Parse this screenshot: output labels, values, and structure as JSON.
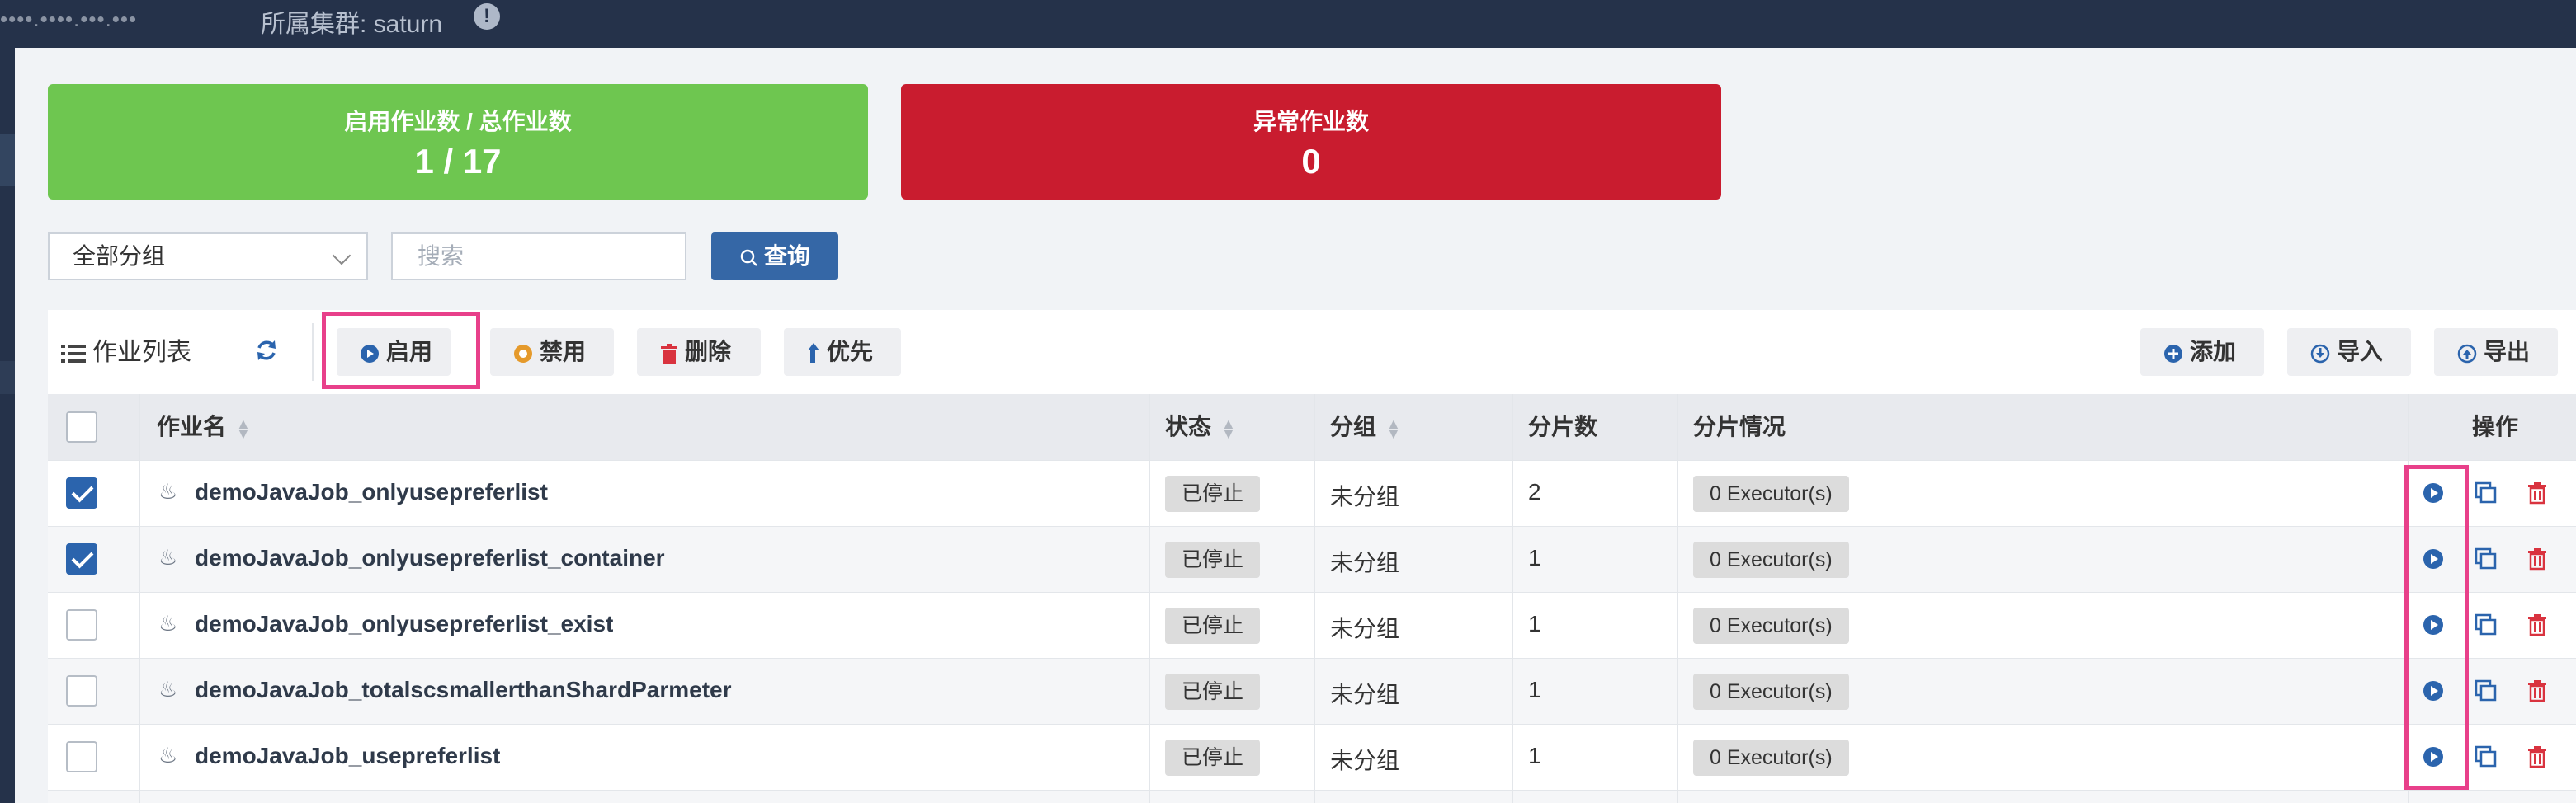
{
  "topbar": {
    "host": "••••.••••.•••.•••",
    "cluster_label": "所属集群: saturn"
  },
  "stats": {
    "enabled_label": "启用作业数 / 总作业数",
    "enabled_value": "1 / 17",
    "abnormal_label": "异常作业数",
    "abnormal_value": "0"
  },
  "filter": {
    "group_selected": "全部分组",
    "search_placeholder": "搜索",
    "query_label": "查询"
  },
  "toolbar": {
    "title": "作业列表",
    "enable_label": "启用",
    "disable_label": "禁用",
    "delete_label": "删除",
    "priority_label": "优先",
    "add_label": "添加",
    "import_label": "导入",
    "export_label": "导出"
  },
  "table": {
    "headers": {
      "name": "作业名",
      "status": "状态",
      "group": "分组",
      "shards": "分片数",
      "shard_status": "分片情况",
      "actions": "操作"
    },
    "rows": [
      {
        "checked": true,
        "name": "demoJavaJob_onlyusepreferlist",
        "status": "已停止",
        "group": "未分组",
        "shards": "2",
        "shard_status": "0 Executor(s)"
      },
      {
        "checked": true,
        "name": "demoJavaJob_onlyusepreferlist_container",
        "status": "已停止",
        "group": "未分组",
        "shards": "1",
        "shard_status": "0 Executor(s)"
      },
      {
        "checked": false,
        "name": "demoJavaJob_onlyusepreferlist_exist",
        "status": "已停止",
        "group": "未分组",
        "shards": "1",
        "shard_status": "0 Executor(s)"
      },
      {
        "checked": false,
        "name": "demoJavaJob_totalscsmallerthanShardParmeter",
        "status": "已停止",
        "group": "未分组",
        "shards": "1",
        "shard_status": "0 Executor(s)"
      },
      {
        "checked": false,
        "name": "demoJavaJob_usepreferlist",
        "status": "已停止",
        "group": "未分组",
        "shards": "1",
        "shard_status": "0 Executor(s)"
      }
    ]
  },
  "colors": {
    "enabled_card": "#6ec650",
    "abnormal_card": "#c91c2f",
    "primary": "#3567a6",
    "highlight_box": "#e8408a",
    "delete_icon": "#d9333f"
  }
}
